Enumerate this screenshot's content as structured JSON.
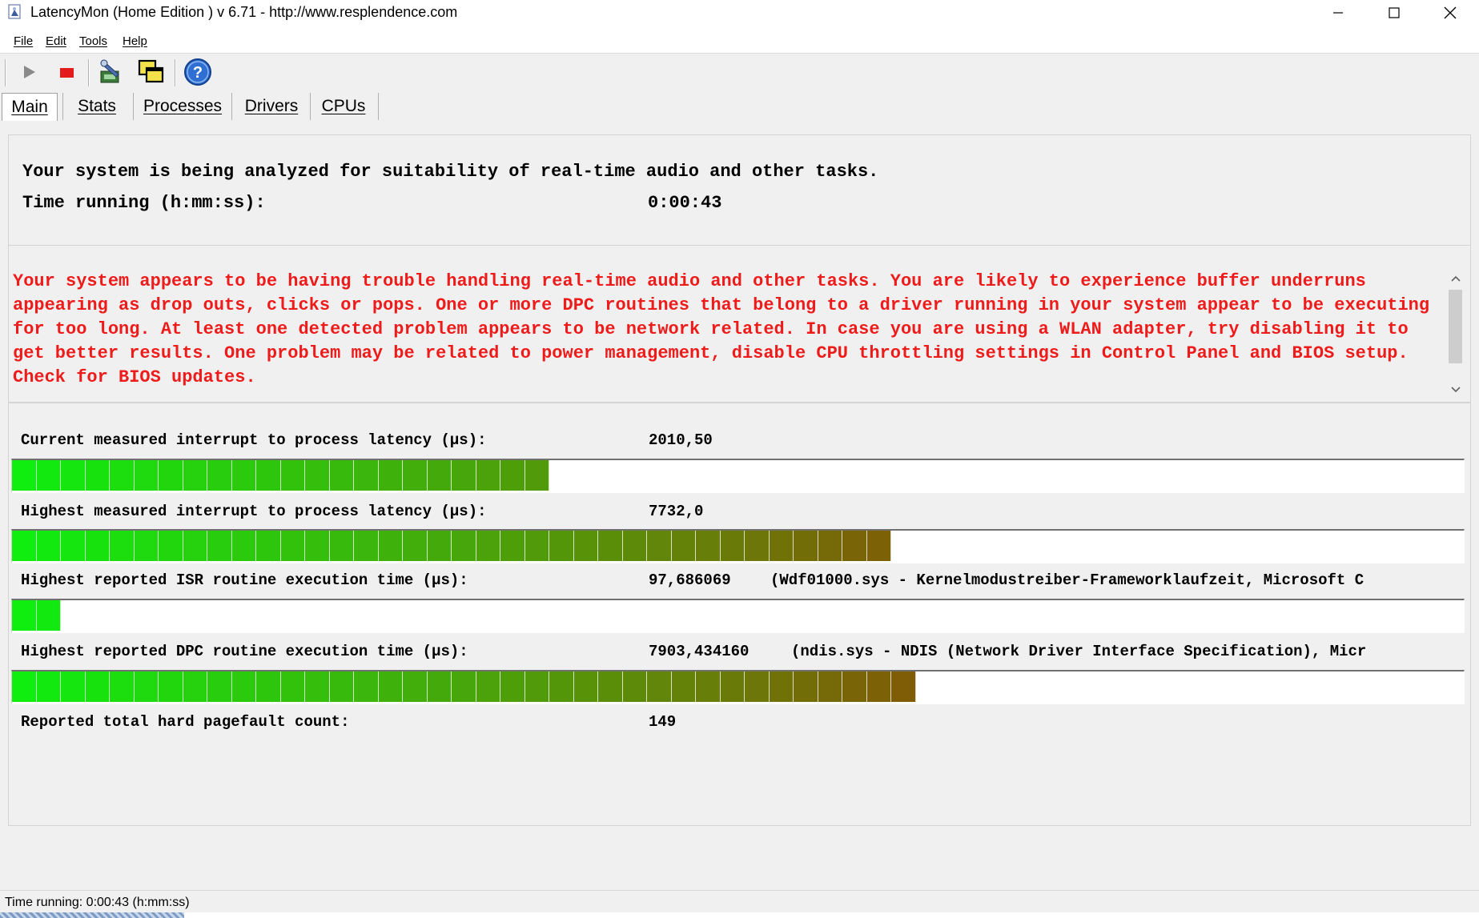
{
  "window": {
    "title": "LatencyMon  (Home Edition )  v 6.71 - http://www.resplendence.com",
    "icon": "latencymon-app-icon",
    "controls": [
      "minimize-icon",
      "maximize-icon",
      "close-icon"
    ]
  },
  "menu": {
    "items": [
      "File",
      "Edit",
      "Tools",
      "Help"
    ]
  },
  "toolbar": {
    "buttons": [
      {
        "name": "play",
        "icon": "play-icon",
        "enabled": false
      },
      {
        "name": "stop",
        "icon": "stop-icon",
        "color": "#e41b1b"
      },
      {
        "name": "analyze",
        "icon": "drivers-tool-icon"
      },
      {
        "name": "windows",
        "icon": "copy-window-icon"
      },
      {
        "name": "help",
        "icon": "help-icon"
      }
    ]
  },
  "tabs": [
    {
      "label": "Main",
      "active": true
    },
    {
      "label": "Stats",
      "active": false
    },
    {
      "label": "Processes",
      "active": false
    },
    {
      "label": "Drivers",
      "active": false
    },
    {
      "label": "CPUs",
      "active": false
    }
  ],
  "main": {
    "header_text": "Your system is being analyzed for suitability of real-time audio and other tasks.",
    "time_label": "Time running (h:mm:ss):",
    "time_value": "0:00:43",
    "warning": "Your system appears to be having trouble handling real-time audio and other tasks. You are likely to experience buffer underruns appearing as drop outs, clicks or pops. One or more DPC routines that belong to a driver running in your system appear to be executing for too long. At least one detected problem appears to be network related. In case you are using a WLAN adapter, try disabling it to get better results. One problem may be related to power management, disable CPU throttling settings in Control Panel and BIOS setup. Check for BIOS updates.",
    "warning_color": "#ee1b1b",
    "metrics": [
      {
        "label": "Current measured interrupt to process latency (µs):",
        "value": "2010,50",
        "extra": "",
        "bar_fill_fraction": 0.367
      },
      {
        "label": "Highest measured interrupt to process latency (µs):",
        "value": "7732,0",
        "extra": "",
        "bar_fill_fraction": 0.603
      },
      {
        "label": "Highest reported ISR routine execution time (µs):",
        "value": "97,686069",
        "extra": "(Wdf01000.sys - Kernelmodustreiber-Frameworklaufzeit, Microsoft C",
        "bar_fill_fraction": 0.03
      },
      {
        "label": "Highest reported DPC routine execution time (µs):",
        "value": "7903,434160",
        "extra": "(ndis.sys - NDIS (Network Driver Interface Specification), Micr",
        "bar_fill_fraction": 0.616
      }
    ],
    "pagefault_label": "Reported total hard pagefault count:",
    "pagefault_value": "149"
  },
  "statusbar": {
    "text": "Time running: 0:00:43  (h:mm:ss)"
  },
  "colors": {
    "bar_start": "#0fee0f",
    "bar_mid": "#6a7a08",
    "bar_end": "#c00000",
    "meter_border": "#707070"
  }
}
